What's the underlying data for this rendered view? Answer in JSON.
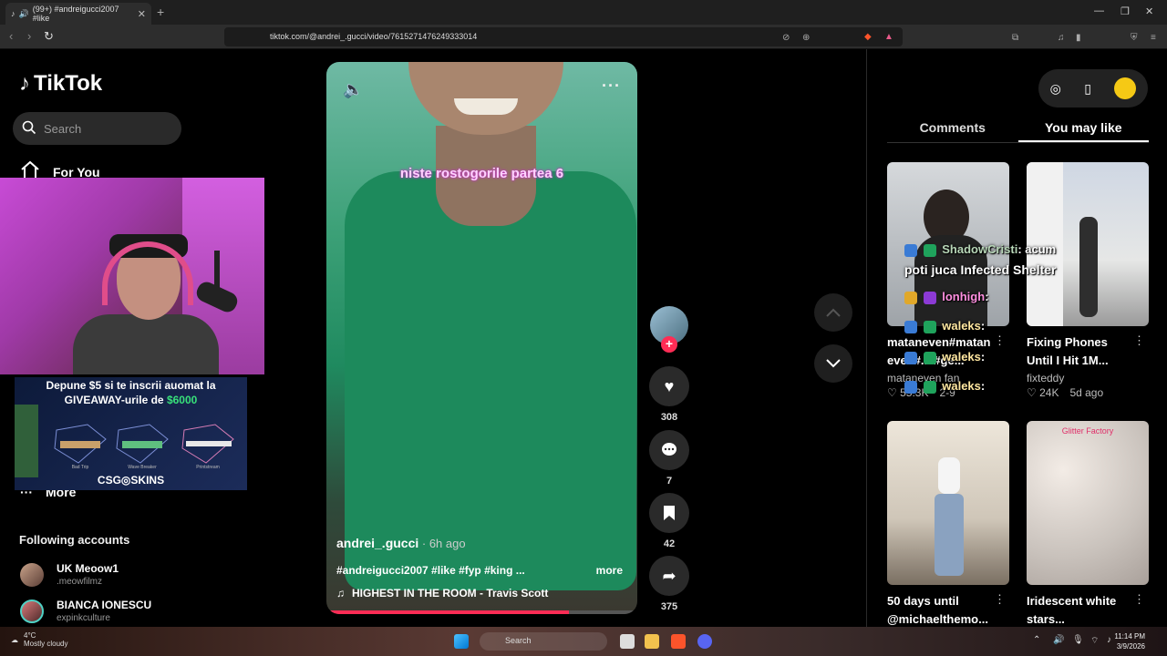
{
  "browser": {
    "tab_title": "(99+) #andreigucci2007 #like",
    "tab_close": "✕",
    "new_tab": "+",
    "url": "tiktok.com/@andrei_.gucci/video/7615271476249333014"
  },
  "sidebar": {
    "logo": "TikTok",
    "search_placeholder": "Search",
    "nav_for_you": "For You",
    "nav_more": "More",
    "following_title": "Following accounts",
    "accounts": [
      {
        "name": "UK Meoow1",
        "handle": ".meowfilmz"
      },
      {
        "name": "BIANCA IONESCU",
        "handle": "expinkculture"
      }
    ]
  },
  "ad": {
    "line1": "Depune $5 si te inscrii auomat la",
    "line2_prefix": "GIVEAWAY-urile de ",
    "line2_amount": "$6000",
    "guns": [
      "Bad Trip",
      "Wave Breaker",
      "Printstream"
    ],
    "brand": "CSG◎SKINS"
  },
  "video": {
    "caption_overlay": "niste rostogorile partea 6",
    "author": "andrei_.gucci",
    "time": " · 6h ago",
    "tags": "#andreigucci2007 #like #fyp #king ...",
    "more": "more",
    "music": "HIGHEST IN THE ROOM - Travis Scott",
    "progress": 0.78
  },
  "actions": {
    "likes": "308",
    "comments": "7",
    "saves": "42",
    "shares": "375"
  },
  "right_panel": {
    "tabs": [
      "Comments",
      "You may like"
    ],
    "active_tab": "You may like",
    "cards": [
      {
        "title": "mataneven#matan even#... #ge...",
        "author": "mataneven fan",
        "likes": "55.3K",
        "age": "2-9"
      },
      {
        "title": "Fixing Phones Until I Hit 1M...",
        "author": "fixteddy",
        "likes": "24K",
        "age": "5d ago"
      },
      {
        "title": "50 days until @michaelthemo...",
        "author": "",
        "likes": "",
        "age": ""
      },
      {
        "title": "Iridescent white stars...",
        "author": "",
        "likes": "",
        "age": ""
      }
    ],
    "glitter_label": "Glitter Factory"
  },
  "chat_overlay": [
    {
      "user": "ShadowCristi",
      "text": ": acum"
    },
    {
      "user": "",
      "text": "poti juca Infected Shelter"
    },
    {
      "user": "lonhigh",
      "text": ":"
    },
    {
      "user": "waleks",
      "text": ":"
    },
    {
      "user": "waleks",
      "text": ":"
    },
    {
      "user": "waleks",
      "text": ":"
    }
  ],
  "taskbar": {
    "weather_temp": "4°C",
    "weather_desc": "Mostly cloudy",
    "search": "Search",
    "time": "11:14 PM",
    "date": "3/9/2026"
  },
  "colors": {
    "accent": "#fe2c55",
    "bg": "#000000",
    "giveaway_green": "#38e07a"
  }
}
